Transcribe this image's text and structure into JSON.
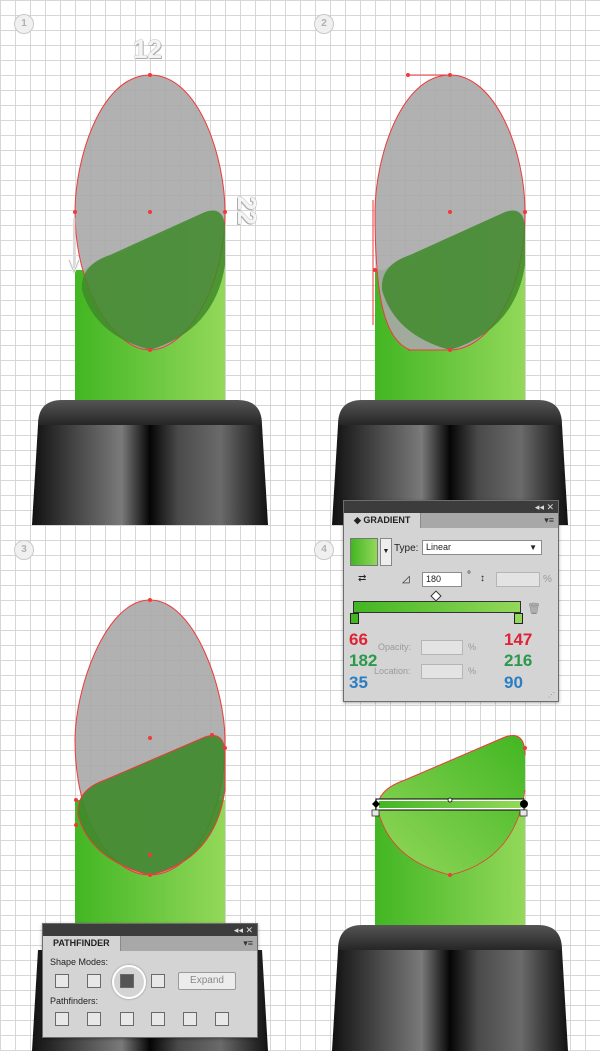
{
  "steps": [
    "1",
    "2",
    "3",
    "4"
  ],
  "dimensions": {
    "width": "12",
    "height": "22"
  },
  "gradient_panel": {
    "title": "GRADIENT",
    "type_label": "Type:",
    "type_value": "Linear",
    "angle_value": "180",
    "degree_symbol": "°",
    "percent_symbol": "%",
    "opacity_label": "Opacity:",
    "location_label": "Location:",
    "left_stop": {
      "r": "66",
      "g": "182",
      "b": "35"
    },
    "right_stop": {
      "r": "147",
      "g": "216",
      "b": "90"
    },
    "panel_controls": "◂◂  ✕",
    "menu_icon": "▾≡"
  },
  "pathfinder_panel": {
    "title": "PATHFINDER",
    "shape_modes_label": "Shape Modes:",
    "pathfinders_label": "Pathfinders:",
    "expand_label": "Expand",
    "panel_controls": "◂◂  ✕",
    "menu_icon": "▾≡"
  },
  "colors": {
    "green_dark": "#42b623",
    "green_light": "#93d85a",
    "overlay_green": "#3f8a2c",
    "gray_shape": "#a8a8a8",
    "path_red": "#ee3a3a"
  }
}
